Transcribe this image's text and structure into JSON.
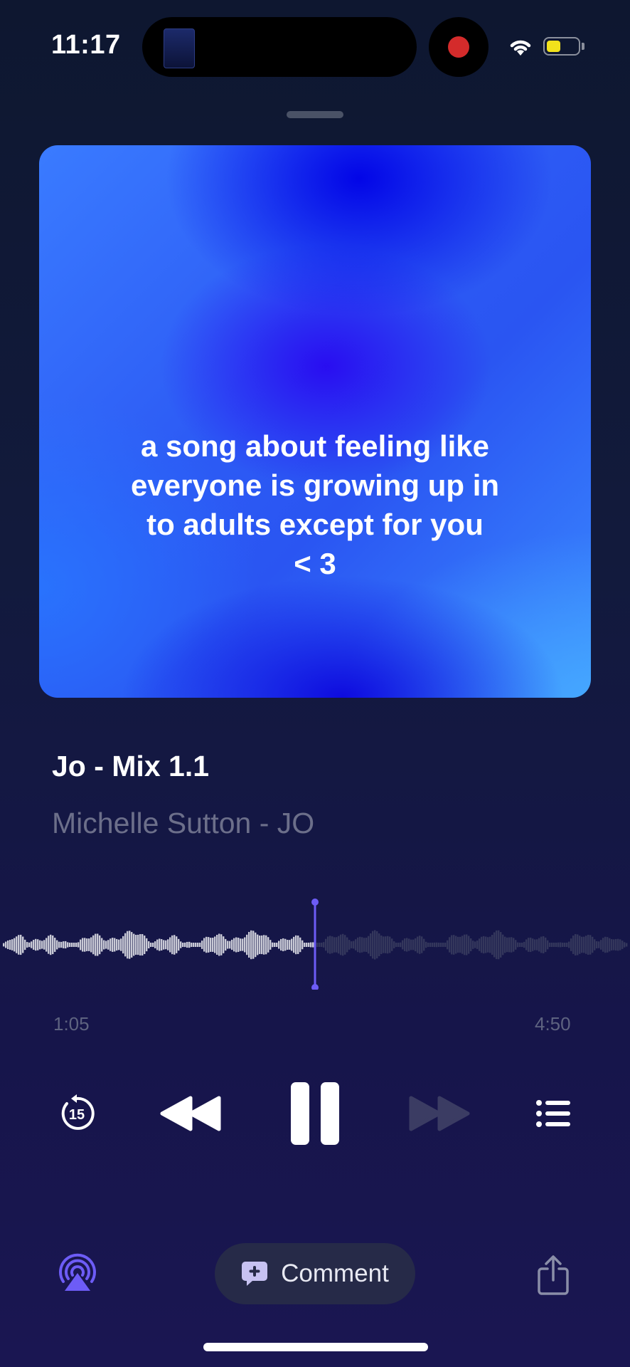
{
  "status_bar": {
    "time": "11:17",
    "recording": true,
    "battery_color": "#f2e21c"
  },
  "artwork": {
    "text": "a song about feeling like\neveryone is growing up in\nto adults except for you\n< 3"
  },
  "track": {
    "title": "Jo - Mix 1.1",
    "artist": "Michelle Sutton - JO"
  },
  "playback": {
    "elapsed": "1:05",
    "duration": "4:50",
    "progress": 0.5,
    "state": "playing"
  },
  "controls": {
    "skip_back_seconds": "15",
    "skip_back_icon": "skip-back-15-icon",
    "rewind_icon": "rewind-icon",
    "pause_icon": "pause-icon",
    "fast_forward_icon": "fast-forward-icon",
    "queue_icon": "queue-list-icon"
  },
  "bottom_bar": {
    "airplay_icon": "airplay-icon",
    "comment_label": "Comment",
    "comment_icon": "comment-plus-icon",
    "share_icon": "share-icon"
  },
  "colors": {
    "accent": "#6d5cf6",
    "background": "#141a3e",
    "dim_text": "#6c6f8a"
  }
}
